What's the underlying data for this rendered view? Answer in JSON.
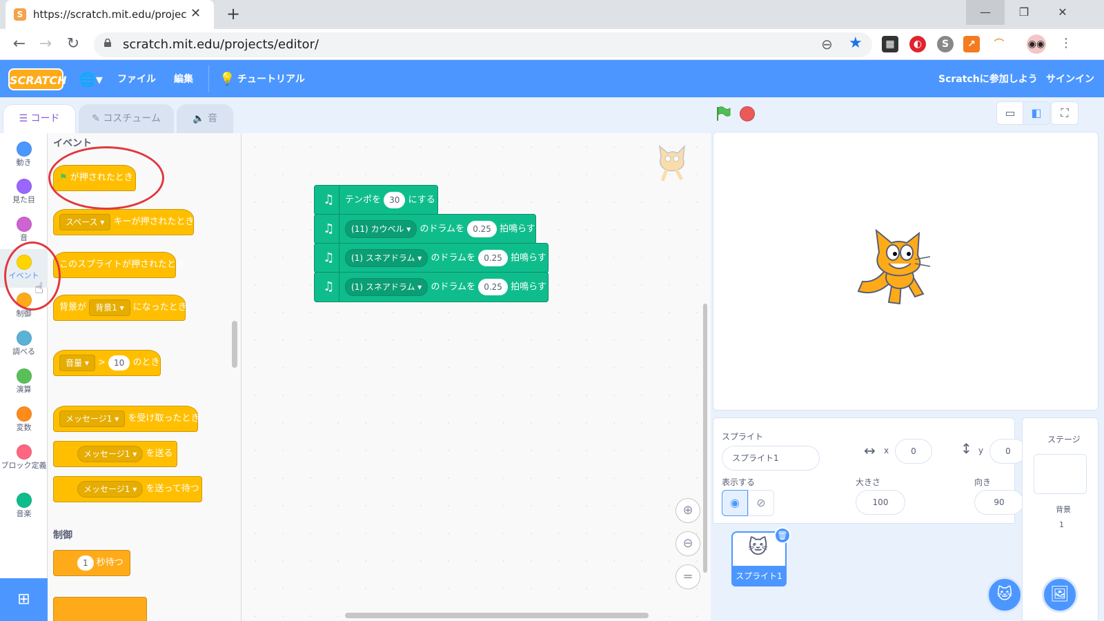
{
  "browser": {
    "tab_title": "https://scratch.mit.edu/projects/e",
    "url": "scratch.mit.edu/projects/editor/",
    "favicon_letter": "S"
  },
  "menu": {
    "logo": "SCRATCH",
    "file": "ファイル",
    "edit": "編集",
    "tutorial": "チュートリアル",
    "join": "Scratchに参加しよう",
    "signin": "サインイン"
  },
  "editor_tabs": {
    "code": "コード",
    "costumes": "コスチューム",
    "sounds": "音"
  },
  "categories": [
    {
      "label": "動き",
      "color": "#4c97ff"
    },
    {
      "label": "見た目",
      "color": "#9966ff"
    },
    {
      "label": "音",
      "color": "#cf63cf"
    },
    {
      "label": "イベント",
      "color": "#ffd500"
    },
    {
      "label": "制御",
      "color": "#ffab19"
    },
    {
      "label": "調べる",
      "color": "#5cb1d6"
    },
    {
      "label": "演算",
      "color": "#59c059"
    },
    {
      "label": "変数",
      "color": "#ff8c1a"
    },
    {
      "label": "ブロック定義",
      "color": "#ff6680"
    },
    {
      "label": "音楽",
      "color": "#0fbd8c"
    }
  ],
  "palette": {
    "events_heading": "イベント",
    "flag_clicked": "が押されたとき",
    "key_dropdown": "スペース",
    "key_pressed": "キーが押されたとき",
    "sprite_clicked": "このスプライトが押されたとき",
    "backdrop_prefix": "背景が",
    "backdrop_dropdown": "背景1",
    "backdrop_suffix": "になったとき",
    "loudness_dropdown": "音量",
    "gt_symbol": ">",
    "loudness_value": "10",
    "loudness_suffix": "のとき",
    "msg_dropdown": "メッセージ1",
    "msg_received": "を受け取ったとき",
    "broadcast": "を送る",
    "broadcast_wait": "を送って待つ",
    "control_heading": "制御",
    "wait_value": "1",
    "wait_suffix": "秒待つ"
  },
  "script": {
    "tempo_label": "テンポを",
    "tempo_value": "30",
    "tempo_suffix": "にする",
    "drums": [
      {
        "drum": "(11) カウベル",
        "mid": "のドラムを",
        "beats": "0.25",
        "suffix": "拍鳴らす"
      },
      {
        "drum": "(1) スネアドラム",
        "mid": "のドラムを",
        "beats": "0.25",
        "suffix": "拍鳴らす"
      },
      {
        "drum": "(1) スネアドラム",
        "mid": "のドラムを",
        "beats": "0.25",
        "suffix": "拍鳴らす"
      }
    ]
  },
  "sprite_info": {
    "sprite_label": "スプライト",
    "sprite_name": "スプライト1",
    "x_label": "x",
    "x_value": "0",
    "y_label": "y",
    "y_value": "0",
    "show_label": "表示する",
    "size_label": "大きさ",
    "size_value": "100",
    "direction_label": "向き",
    "direction_value": "90",
    "thumb_name": "スプライト1"
  },
  "stage_pane": {
    "title": "ステージ",
    "backdrops_label": "背景",
    "backdrops_count": "1"
  },
  "colors": {
    "accent": "#4c97ff",
    "events": "#ffbf00",
    "music": "#0fbd8c",
    "annotation": "#e0383e"
  }
}
